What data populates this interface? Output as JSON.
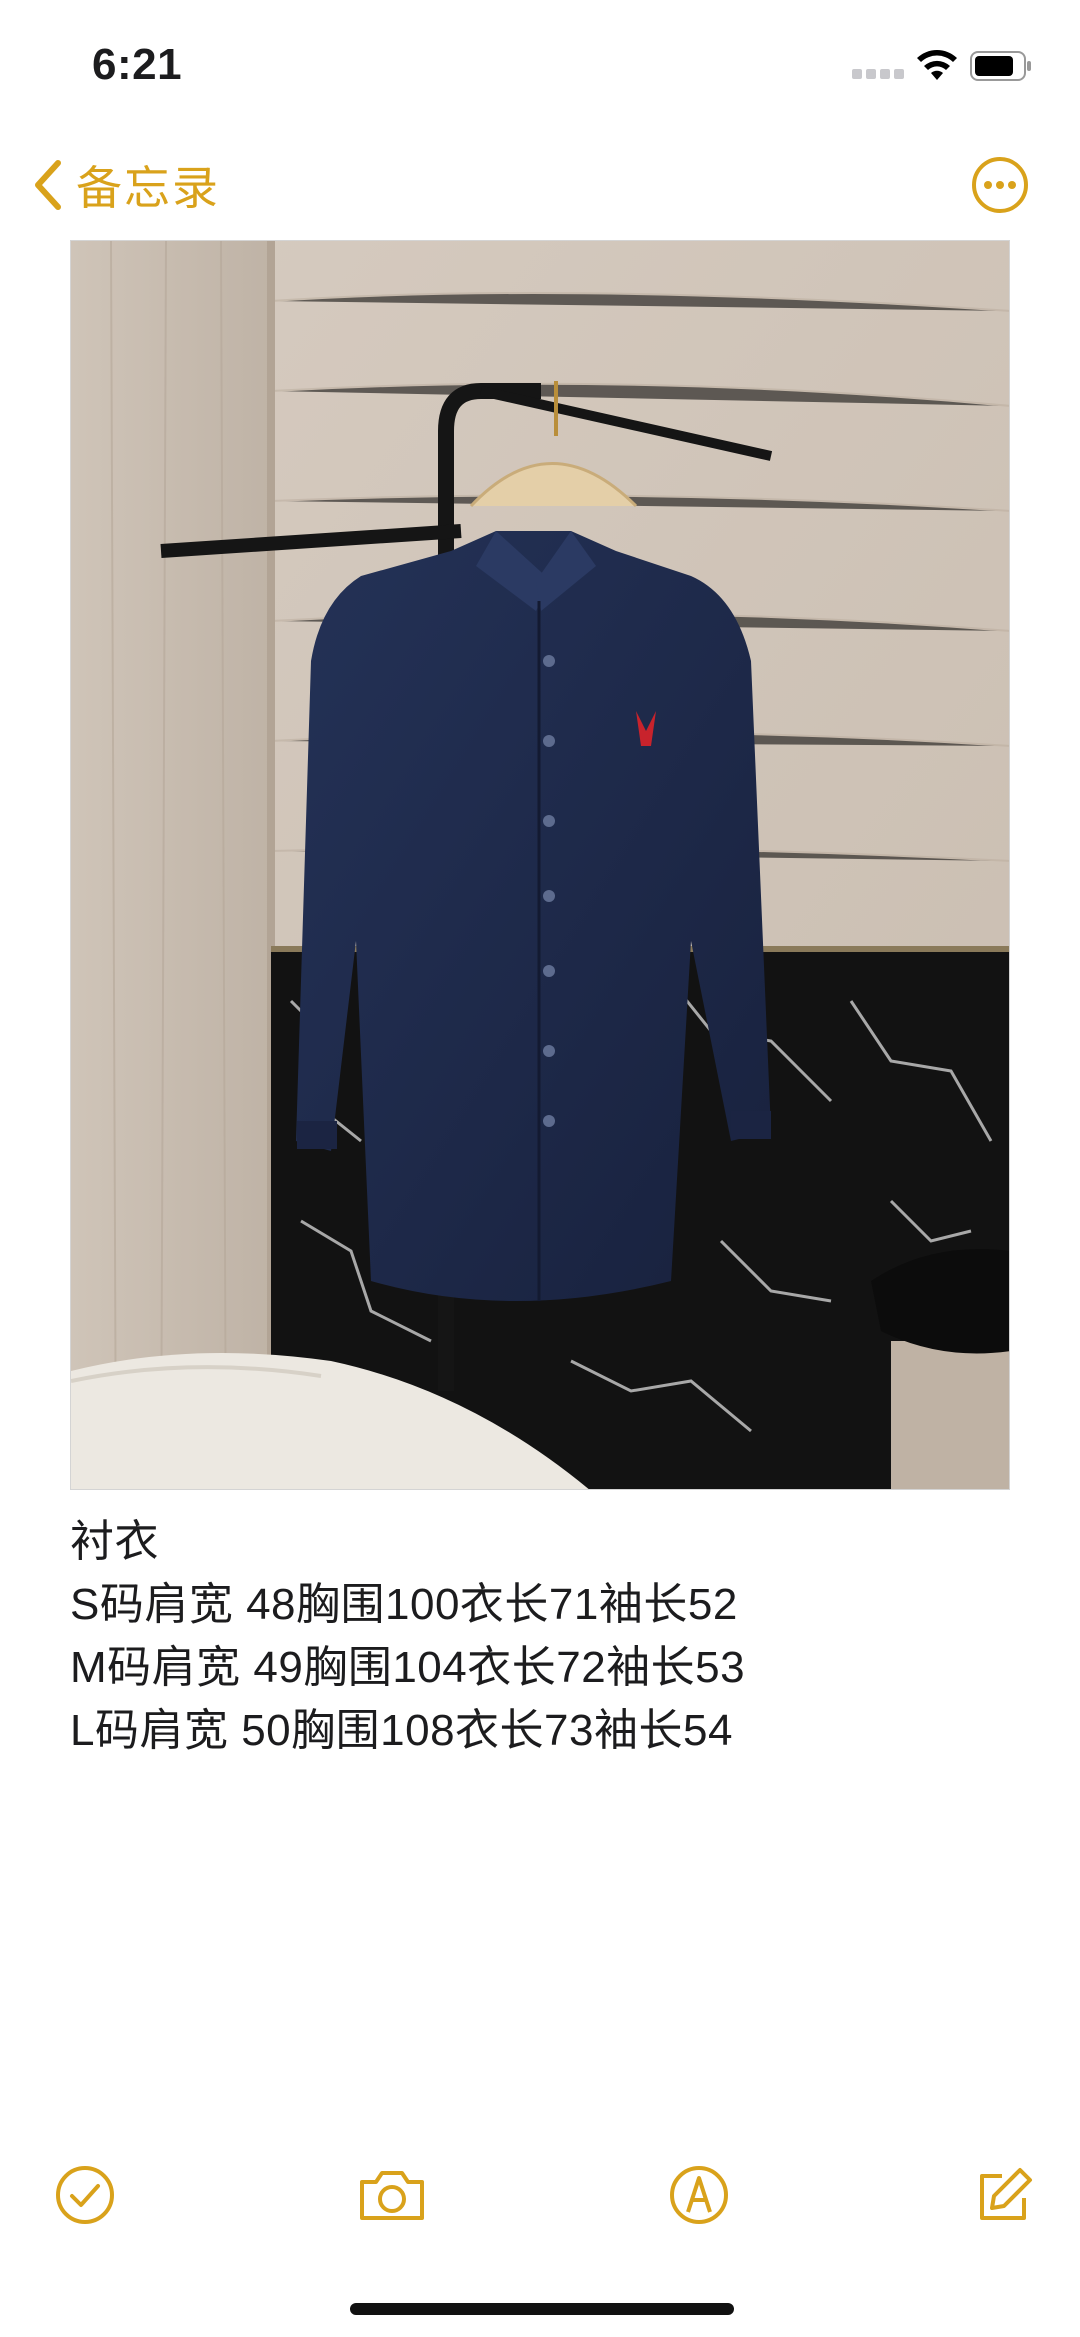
{
  "status_bar": {
    "time": "6:21",
    "icons": [
      "signal-icon",
      "wifi-icon",
      "battery-icon"
    ]
  },
  "nav": {
    "back_label": "备忘录",
    "back_icon": "chevron-left-icon",
    "more_icon": "ellipsis-circle-icon"
  },
  "photo": {
    "subject": "navy-blue shirt on hanger"
  },
  "note": {
    "lines": [
      "衬衣",
      "S码肩宽 48胸围100衣长71袖长52",
      "M码肩宽 49胸围104衣长72袖长53",
      "L码肩宽 50胸围108衣长73袖长54"
    ]
  },
  "toolbar": {
    "icons": [
      "checklist-icon",
      "camera-icon",
      "markup-icon",
      "compose-icon"
    ]
  },
  "colors": {
    "accent": "#d9a21b",
    "text": "#1c1c1e",
    "background": "#ffffff"
  }
}
